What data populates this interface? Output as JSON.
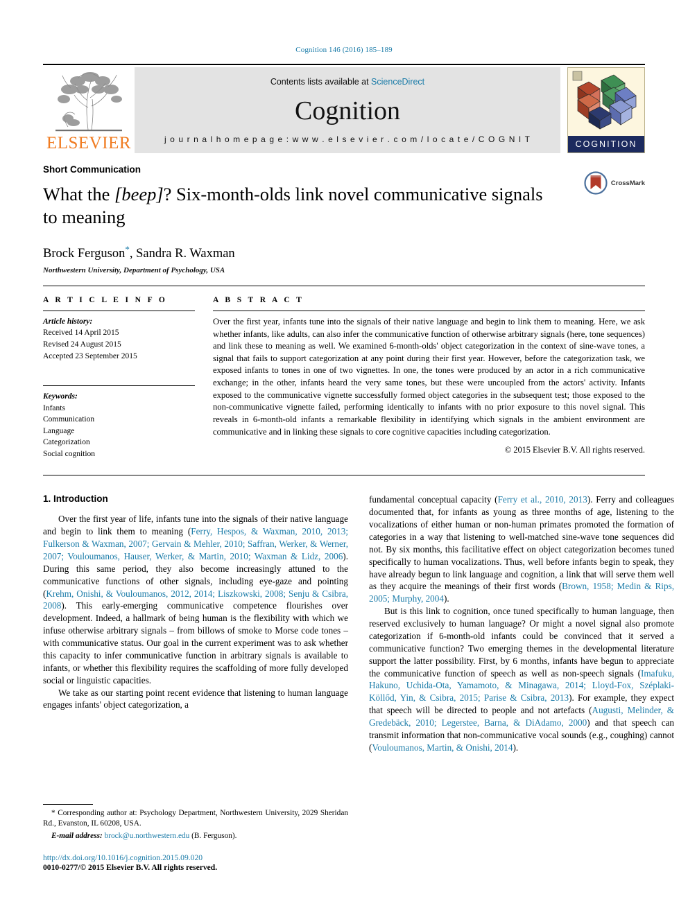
{
  "running_head": "Cognition 146 (2016) 185–189",
  "masthead": {
    "elsevier_word": "ELSEVIER",
    "contents_prefix": "Contents lists available at ",
    "sciencedirect": "ScienceDirect",
    "journal_title": "Cognition",
    "homepage": "j o u r n a l   h o m e p a g e :   w w w . e l s e v i e r . c o m / l o c a t e / C O G N I T",
    "cover_band": "COGNITION"
  },
  "title_block": {
    "kicker": "Short Communication",
    "title_part1": "What the ",
    "title_italic": "[beep]",
    "title_part2": "? Six-month-olds link novel communicative signals to meaning",
    "authors": "Brock Ferguson",
    "author_star": "*",
    "authors_rest": ", Sandra R. Waxman",
    "affiliation": "Northwestern University, Department of Psychology, USA",
    "crossmark_label": "CrossMark"
  },
  "article_info": {
    "heading": "A R T I C L E   I N F O",
    "history_label": "Article history:",
    "history": [
      "Received 14 April 2015",
      "Revised 24 August 2015",
      "Accepted 23 September 2015"
    ],
    "keywords_label": "Keywords:",
    "keywords": [
      "Infants",
      "Communication",
      "Language",
      "Categorization",
      "Social cognition"
    ]
  },
  "abstract": {
    "heading": "A B S T R A C T",
    "text": "Over the first year, infants tune into the signals of their native language and begin to link them to meaning. Here, we ask whether infants, like adults, can also infer the communicative function of otherwise arbitrary signals (here, tone sequences) and link these to meaning as well. We examined 6-month-olds' object categorization in the context of sine-wave tones, a signal that fails to support categorization at any point during their first year. However, before the categorization task, we exposed infants to tones in one of two vignettes. In one, the tones were produced by an actor in a rich communicative exchange; in the other, infants heard the very same tones, but these were uncoupled from the actors' activity. Infants exposed to the communicative vignette successfully formed object categories in the subsequent test; those exposed to the non-communicative vignette failed, performing identically to infants with no prior exposure to this novel signal. This reveals in 6-month-old infants a remarkable flexibility in identifying which signals in the ambient environment are communicative and in linking these signals to core cognitive capacities including categorization.",
    "copyright": "© 2015 Elsevier B.V. All rights reserved."
  },
  "body": {
    "intro_heading": "1. Introduction",
    "left_p1_a": "Over the first year of life, infants tune into the signals of their native language and begin to link them to meaning (",
    "left_p1_ref1": "Ferry, Hespos, & Waxman, 2010, 2013; Fulkerson & Waxman, 2007; Gervain & Mehler, 2010; Saffran, Werker, & Werner, 2007; Vouloumanos, Hauser, Werker, & Martin, 2010; Waxman & Lidz, 2006",
    "left_p1_b": "). During this same period, they also become increasingly attuned to the communicative functions of other signals, including eye-gaze and pointing (",
    "left_p1_ref2": "Krehm, Onishi, & Vouloumanos, 2012, 2014; Liszkowski, 2008; Senju & Csibra, 2008",
    "left_p1_c": "). This early-emerging communicative competence flourishes over development. Indeed, a hallmark of being human is the flexibility with which we infuse otherwise arbitrary signals – from billows of smoke to Morse code tones – with communicative status. Our goal in the current experiment was to ask whether this capacity to infer communicative function in arbitrary signals is available to infants, or whether this flexibility requires the scaffolding of more fully developed social or linguistic capacities.",
    "left_p2": "We take as our starting point recent evidence that listening to human language engages infants' object categorization, a",
    "right_p1_a": "fundamental conceptual capacity (",
    "right_p1_ref1": "Ferry et al., 2010, 2013",
    "right_p1_b": "). Ferry and colleagues documented that, for infants as young as three months of age, listening to the vocalizations of either human or non-human primates promoted the formation of categories in a way that listening to well-matched sine-wave tone sequences did not. By six months, this facilitative effect on object categorization becomes tuned specifically to human vocalizations. Thus, well before infants begin to speak, they have already begun to link language and cognition, a link that will serve them well as they acquire the meanings of their first words (",
    "right_p1_ref2": "Brown, 1958; Medin & Rips, 2005; Murphy, 2004",
    "right_p1_c": ").",
    "right_p2_a": "But is this link to cognition, once tuned specifically to human language, then reserved exclusively to human language? Or might a novel signal also promote categorization if 6-month-old infants could be convinced that it served a communicative function? Two emerging themes in the developmental literature support the latter possibility. First, by 6 months, infants have begun to appreciate the communicative function of speech as well as non-speech signals (",
    "right_p2_ref1": "Imafuku, Hakuno, Uchida-Ota, Yamamoto, & Minagawa, 2014; Lloyd-Fox, Széplaki-Köllőd, Yin, & Csibra, 2015; Parise & Csibra, 2013",
    "right_p2_b": "). For example, they expect that speech will be directed to people and not artefacts (",
    "right_p2_ref2": "Augusti, Melinder, & Gredebäck, 2010; Legerstee, Barna, & DiAdamo, 2000",
    "right_p2_c": ") and that speech can transmit information that non-communicative vocal sounds (e.g., coughing) cannot (",
    "right_p2_ref3": "Vouloumanos, Martin, & Onishi, 2014",
    "right_p2_d": ")."
  },
  "footnotes": {
    "corresponding_star": "*",
    "corresponding": "Corresponding author at: Psychology Department, Northwestern University, 2029 Sheridan Rd., Evanston, IL 60208, USA.",
    "email_label": "E-mail address:",
    "email": "brock@u.northwestern.edu",
    "email_attrib": "(B. Ferguson).",
    "doi": "http://dx.doi.org/10.1016/j.cognition.2015.09.020",
    "issn": "0010-0277/© 2015 Elsevier B.V. All rights reserved."
  },
  "colors": {
    "link": "#1a7ba8",
    "elsevier_orange": "#f07c22",
    "masthead_gray": "#e3e3e3",
    "cover_band": "#1c2a5e"
  }
}
